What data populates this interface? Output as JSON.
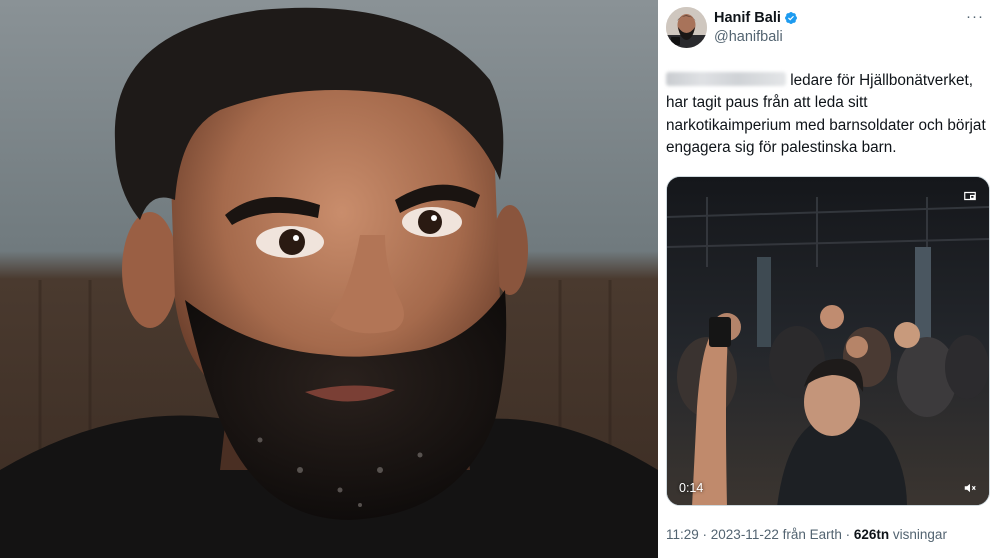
{
  "tweet": {
    "author_name": "Hanif Bali",
    "author_handle": "@hanifbali",
    "more_icon": "···",
    "verified_color": "#1d9bf0",
    "text_after_blur": "ledare för Hjällbonätverket, har tagit paus från att leda sitt narkotikaimperium med barnsoldater och börjat engagera sig för palestinska barn.",
    "video": {
      "duration": "0:14"
    },
    "meta": {
      "time": "11:29",
      "separator1": " · ",
      "date": "2023-11-22 från Earth",
      "separator2": " · ",
      "views_count": "626tn",
      "views_label": " visningar"
    }
  }
}
